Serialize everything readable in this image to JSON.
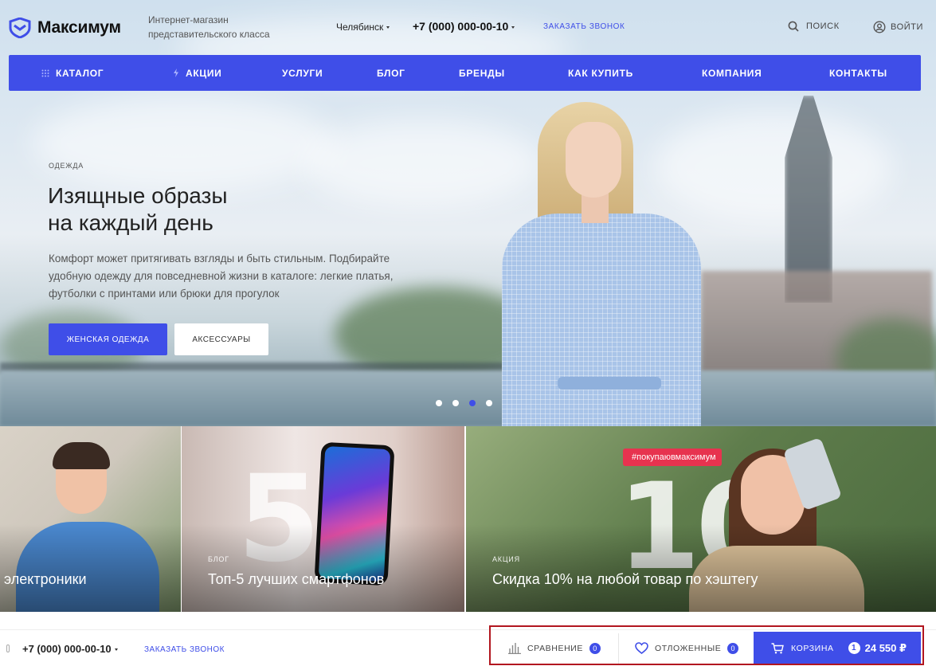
{
  "header": {
    "logo_text": "Максимум",
    "tagline_line1": "Интернет-магазин",
    "tagline_line2": "представительского класса",
    "city": "Челябинск",
    "phone": "+7 (000) 000-00-10",
    "callback": "ЗАКАЗАТЬ ЗВОНОК",
    "search_label": "ПОИСК",
    "login_label": "ВОЙТИ"
  },
  "nav": {
    "items": [
      {
        "label": "КАТАЛОГ",
        "icon": "grid-icon"
      },
      {
        "label": "АКЦИИ",
        "icon": "lightning-icon"
      },
      {
        "label": "УСЛУГИ"
      },
      {
        "label": "БЛОГ"
      },
      {
        "label": "БРЕНДЫ"
      },
      {
        "label": "КАК КУПИТЬ"
      },
      {
        "label": "КОМПАНИЯ"
      },
      {
        "label": "КОНТАКТЫ"
      }
    ]
  },
  "hero": {
    "eyebrow": "ОДЕЖДА",
    "title_line1": "Изящные образы",
    "title_line2": "на каждый день",
    "text": "Комфорт может притягивать взгляды и быть стильным. Подбирайте удобную одежду для повседневной жизни в каталоге: легкие платья, футболки с принтами или брюки для прогулок",
    "primary_button": "ЖЕНСКАЯ ОДЕЖДА",
    "secondary_button": "АКСЕССУАРЫ",
    "slides_count": 4,
    "active_slide": 3
  },
  "banners": [
    {
      "label": "",
      "title": "электроники"
    },
    {
      "label": "БЛОГ",
      "title": "Топ-5 лучших смартфонов",
      "big_number": "5"
    },
    {
      "label": "АКЦИЯ",
      "title": "Скидка 10% на любой товар по хэштегу",
      "hashtag": "#покупаювмаксимум",
      "big_number": "10"
    }
  ],
  "bottombar": {
    "phone": "+7 (000) 000-00-10",
    "callback": "ЗАКАЗАТЬ ЗВОНОК",
    "compare_label": "СРАВНЕНИЕ",
    "compare_count": "0",
    "favorites_label": "ОТЛОЖЕННЫЕ",
    "favorites_count": "0",
    "cart_label": "КОРЗИНА",
    "cart_count": "1",
    "cart_total": "24 550 ₽"
  },
  "colors": {
    "accent": "#3f4ee8",
    "highlight_frame": "#b2161f"
  }
}
